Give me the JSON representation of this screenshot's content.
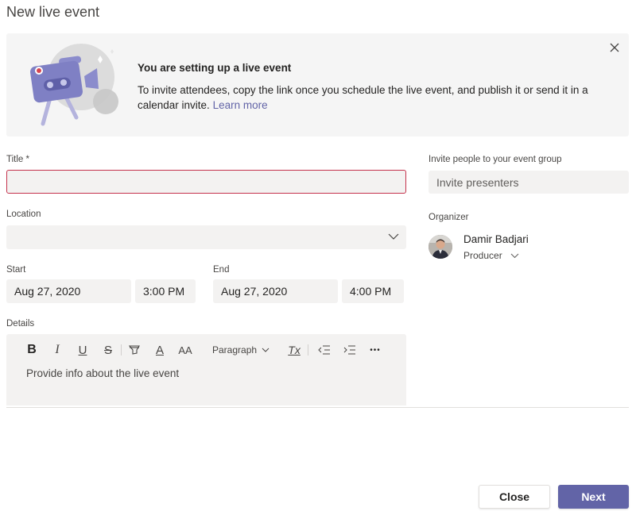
{
  "dialog": {
    "title": "New live event"
  },
  "banner": {
    "title": "You are setting up a live event",
    "text": "To invite attendees, copy the link once you schedule the live event, and publish it or send it in a calendar invite.",
    "link_label": "Learn more",
    "close_icon": "close-icon",
    "illustration": "camera-illustration"
  },
  "form": {
    "title_label": "Title *",
    "title_value": "",
    "location_label": "Location",
    "location_value": "",
    "start_label": "Start",
    "start_date": "Aug 27, 2020",
    "start_time": "3:00 PM",
    "end_label": "End",
    "end_date": "Aug 27, 2020",
    "end_time": "4:00 PM",
    "details_label": "Details",
    "details_placeholder": "Provide info about the live event"
  },
  "toolbar": {
    "bold": "B",
    "italic": "I",
    "underline": "U",
    "strikethrough": "S",
    "highlight_icon": "highlight-icon",
    "font_color": "A",
    "font_size": "AA",
    "paragraph_label": "Paragraph",
    "clear_format": "Tx",
    "more": "•••"
  },
  "invite": {
    "label": "Invite people to your event group",
    "placeholder": "Invite presenters"
  },
  "organizer": {
    "label": "Organizer",
    "name": "Damir Badjari",
    "role": "Producer"
  },
  "footer": {
    "close_label": "Close",
    "next_label": "Next"
  },
  "colors": {
    "accent": "#6264a7",
    "error": "#c4314b",
    "field_bg": "#f3f2f1",
    "banner_bg": "#f5f5f5"
  }
}
